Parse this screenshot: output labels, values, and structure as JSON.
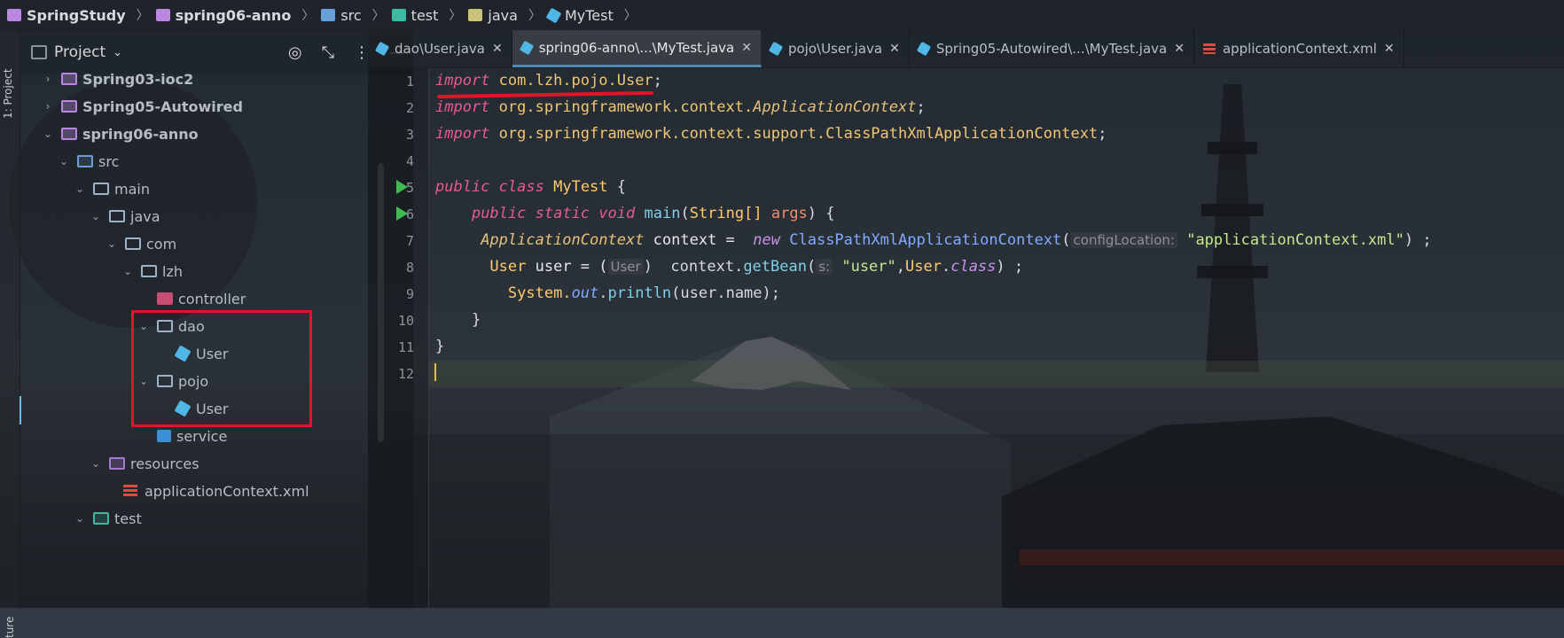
{
  "breadcrumb": [
    {
      "label": "SpringStudy",
      "icon": "module-folder-icon",
      "color": "#b987e0"
    },
    {
      "label": "spring06-anno",
      "icon": "module-folder-icon",
      "color": "#b987e0"
    },
    {
      "label": "src",
      "icon": "source-folder-icon",
      "color": "#6aa0d8"
    },
    {
      "label": "test",
      "icon": "test-folder-icon",
      "color": "#3fb9a2"
    },
    {
      "label": "java",
      "icon": "folder-icon",
      "color": "#c8c27a"
    },
    {
      "label": "MyTest",
      "icon": "class-icon",
      "color": "#4fb6e6"
    }
  ],
  "sidebar": {
    "tool_label": "1: Project",
    "tool_label_bottom": "ture",
    "header": {
      "title": "Project",
      "dropdown_icon": "chevron-down-icon"
    },
    "tree": [
      {
        "label": "Spring03-ioc2",
        "type": "module",
        "arrow": "›"
      },
      {
        "label": "Spring05-Autowired",
        "type": "folder",
        "arrow": "›"
      },
      {
        "label": "spring06-anno",
        "type": "folder",
        "arrow": "⌄"
      },
      {
        "label": "src",
        "type": "src",
        "arrow": "⌄"
      },
      {
        "label": "main",
        "type": "folder",
        "arrow": "⌄"
      },
      {
        "label": "java",
        "type": "folder",
        "arrow": "⌄"
      },
      {
        "label": "com",
        "type": "folder",
        "arrow": "⌄"
      },
      {
        "label": "lzh",
        "type": "folder",
        "arrow": "⌄"
      },
      {
        "label": "controller",
        "type": "controller",
        "arrow": ""
      },
      {
        "label": "dao",
        "type": "folder",
        "arrow": "⌄"
      },
      {
        "label": "User",
        "type": "class",
        "arrow": ""
      },
      {
        "label": "pojo",
        "type": "folder",
        "arrow": "⌄"
      },
      {
        "label": "User",
        "type": "class",
        "arrow": ""
      },
      {
        "label": "service",
        "type": "service",
        "arrow": ""
      },
      {
        "label": "resources",
        "type": "resources",
        "arrow": "⌄"
      },
      {
        "label": "applicationContext.xml",
        "type": "xml",
        "arrow": ""
      },
      {
        "label": "test",
        "type": "test",
        "arrow": "⌄"
      }
    ]
  },
  "tabs": [
    {
      "label": "dao\\User.java",
      "icon": "class-icon",
      "active": false
    },
    {
      "label": "spring06-anno\\...\\MyTest.java",
      "icon": "class-icon",
      "active": true
    },
    {
      "label": "pojo\\User.java",
      "icon": "class-icon",
      "active": false
    },
    {
      "label": "Spring05-Autowired\\...\\MyTest.java",
      "icon": "class-icon",
      "active": false
    },
    {
      "label": "applicationContext.xml",
      "icon": "xml-file-icon",
      "active": false
    }
  ],
  "editor": {
    "line_numbers": [
      "1",
      "2",
      "3",
      "4",
      "5",
      "6",
      "7",
      "8",
      "9",
      "10",
      "11",
      "12"
    ],
    "code": {
      "l1_kw": "import",
      "l1_pkg": "com.lzh.pojo.User",
      "l1_end": ";",
      "l2_kw": "import",
      "l2_pkg": "org.springframework.context.",
      "l2_cls": "ApplicationContext",
      "l2_end": ";",
      "l3_kw": "import",
      "l3_pkg": "org.springframework.context.support.ClassPathXmlApplicationContext",
      "l3_end": ";",
      "l5_kw1": "public",
      "l5_kw2": "class",
      "l5_name": "MyTest",
      "l5_end": "{",
      "l6_kw1": "public",
      "l6_kw2": "static",
      "l6_kw3": "void",
      "l6_name": "main",
      "l6_p1": "(",
      "l6_type": "String[]",
      "l6_arg": "args",
      "l6_end": ") {",
      "l7_type": "ApplicationContext",
      "l7_var": "context =",
      "l7_new": "new",
      "l7_cls": "ClassPathXmlApplicationContext",
      "l7_p": "(",
      "l7_hint": "configLocation:",
      "l7_str": "\"applicationContext.xml\"",
      "l7_end": ") ;",
      "l8_type": "User",
      "l8_var": "user = (",
      "l8_cast": "User",
      "l8_mid": ")  context.",
      "l8_m": "getBean",
      "l8_p": "(",
      "l8_hint": "s:",
      "l8_str": "\"user\"",
      "l8_comma": ",",
      "l8_cls": "User",
      "l8_dot": ".",
      "l8_kw": "class",
      "l8_end": ") ;",
      "l9_pre": "System.",
      "l9_fld": "out",
      "l9_dot": ".",
      "l9_m": "println",
      "l9_end": "(user.name);",
      "l10": "}",
      "l11": "}"
    }
  }
}
